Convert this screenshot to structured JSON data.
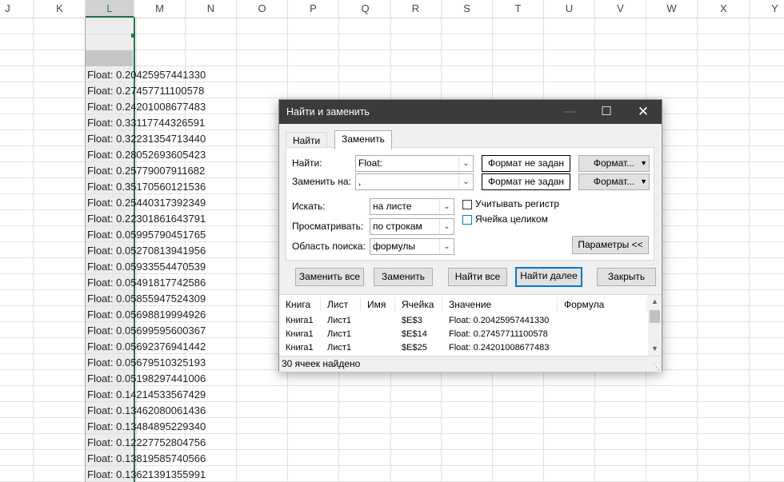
{
  "sheet": {
    "columns": [
      "J",
      "K",
      "L",
      "M",
      "N",
      "O",
      "P",
      "Q",
      "R",
      "S",
      "T",
      "U",
      "V",
      "W",
      "X",
      "Y"
    ],
    "selected_column": "L",
    "cells": [
      "Float: 0.20425957441330",
      "Float: 0.27457711100578",
      "Float: 0.24201008677483",
      "Float: 0.33117744326591",
      "Float: 0.32231354713440",
      "Float: 0.28052693605423",
      "Float: 0.25779007911682",
      "Float: 0.35170560121536",
      "Float: 0.25440317392349",
      "Float: 0.22301861643791",
      "Float: 0.05995790451765",
      "Float: 0.05270813941956",
      "Float: 0.05933554470539",
      "Float: 0.05491817742586",
      "Float: 0.05855947524309",
      "Float: 0.05698819994926",
      "Float: 0.05699595600367",
      "Float: 0.05692376941442",
      "Float: 0.05679510325193",
      "Float: 0.05198297441006",
      "Float: 0.14214533567429",
      "Float: 0.13462080061436",
      "Float: 0.13484895229340",
      "Float: 0.12227752804756",
      "Float: 0.13819585740566",
      "Float: 0.13621391355991"
    ]
  },
  "dialog": {
    "title": "Найти и заменить",
    "minimize_icon": "minimize-icon",
    "maximize_icon": "maximize-icon",
    "close_icon": "close-icon",
    "tabs": [
      {
        "label": "Найти",
        "active": false
      },
      {
        "label": "Заменить",
        "active": true
      }
    ],
    "find_label": "Найти:",
    "find_value": "Float:",
    "replace_label": "Заменить на:",
    "replace_value": ",",
    "format_not_set": "Формат не задан",
    "format_button": "Формат...",
    "within_label": "Искать:",
    "within_value": "на листе",
    "search_label": "Просматривать:",
    "search_value": "по строкам",
    "lookin_label": "Область поиска:",
    "lookin_value": "формулы",
    "match_case_label": "Учитывать регистр",
    "match_entire_label": "Ячейка целиком",
    "options_button": "Параметры <<",
    "replace_all_button": "Заменить все",
    "replace_button": "Заменить",
    "find_all_button": "Найти все",
    "find_next_button": "Найти далее",
    "close_button": "Закрыть",
    "results": {
      "headers": [
        "Книга",
        "Лист",
        "Имя",
        "Ячейка",
        "Значение",
        "Формула"
      ],
      "rows": [
        [
          "Книга1",
          "Лист1",
          "",
          "$E$3",
          "Float: 0.20425957441330",
          ""
        ],
        [
          "Книга1",
          "Лист1",
          "",
          "$E$14",
          "Float: 0.27457711100578",
          ""
        ],
        [
          "Книга1",
          "Лист1",
          "",
          "$E$25",
          "Float: 0.24201008677483",
          ""
        ]
      ]
    },
    "status": "30 ячеек найдено"
  }
}
